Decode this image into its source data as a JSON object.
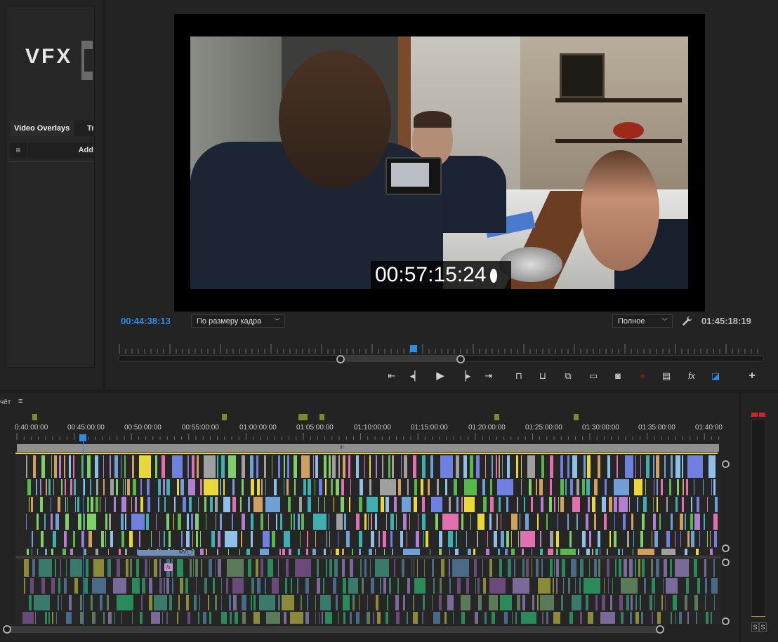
{
  "left_panel": {
    "logo_text": "VFX",
    "tabs": [
      "Video Overlays",
      "Tr"
    ],
    "menu_icon": "≡",
    "add_label": "Add"
  },
  "monitor": {
    "video_timecode": "00:57:15:24",
    "playhead_time": "00:44:38:13",
    "fit_select": "По размеру кадра",
    "quality_select": "Полное",
    "duration": "01:45:18:19"
  },
  "transport": {
    "icons": [
      "go-to-in-icon",
      "step-back-icon",
      "play-icon",
      "step-forward-icon",
      "go-to-out-icon",
      "lift-icon",
      "extract-icon",
      "export-frame-icon",
      "safe-margins-icon",
      "camera-icon",
      "record-icon",
      "multicam-icon",
      "fx-icon",
      "comparison-icon",
      "add-button-icon"
    ],
    "fx_label": "fx",
    "add_label": "+"
  },
  "timeline": {
    "title": "чёт",
    "menu_icon": "≡",
    "ruler_labels": [
      "0:40:00:00",
      "00:45:00:00",
      "00:50:00:00",
      "00:55:00:00",
      "01:00:00:00",
      "01:05:00:00",
      "01:10:00:00",
      "01:15:00:00",
      "01:20:00:00",
      "01:25:00:00",
      "01:30:00:00",
      "01:35:00:00",
      "01:40:00"
    ],
    "clip_label": "MVI_7",
    "fx_badge": "fx",
    "workarea_grip": "lll"
  },
  "meter": {
    "solo_left": "S",
    "solo_right": "S"
  },
  "colors": {
    "accent_blue": "#2d8ceb",
    "work_line_yellow": "#e8d83a",
    "meter_clip_red": "#d2242c",
    "marker_green": "#7a8a2c"
  }
}
